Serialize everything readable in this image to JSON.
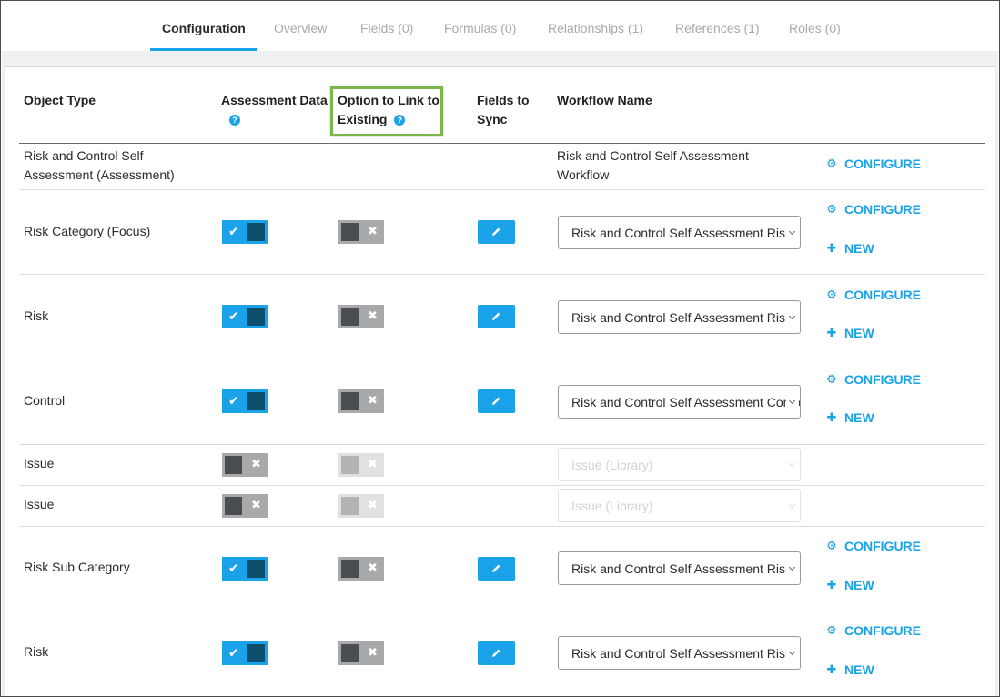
{
  "tabs": [
    {
      "label": "Configuration",
      "active": true
    },
    {
      "label": "Overview"
    },
    {
      "label": "Fields (0)"
    },
    {
      "label": "Formulas (0)"
    },
    {
      "label": "Relationships (1)"
    },
    {
      "label": "References (1)"
    },
    {
      "label": "Roles (0)"
    }
  ],
  "headers": {
    "object_type": "Object Type",
    "assessment_data": "Assessment Data",
    "option_link_1": "Option to Link to",
    "option_link_2": "Existing",
    "fields_sync_1": "Fields to",
    "fields_sync_2": "Sync",
    "workflow_name": "Workflow Name",
    "help_glyph": "?"
  },
  "first_row": {
    "object_line1": "Risk and Control Self",
    "object_line2": "Assessment (Assessment)",
    "workflow_line1": "Risk and Control Self Assessment",
    "workflow_line2": "Workflow",
    "configure": "CONFIGURE"
  },
  "rows": [
    {
      "object": "Risk Category (Focus)",
      "assessment": "on",
      "link": "off",
      "workflow": "Risk and Control Self Assessment Risk",
      "configure": "CONFIGURE",
      "new": "NEW"
    },
    {
      "object": "Risk",
      "assessment": "on",
      "link": "off",
      "workflow": "Risk and Control Self Assessment Risk",
      "configure": "CONFIGURE",
      "new": "NEW"
    },
    {
      "object": "Control",
      "assessment": "on",
      "link": "off",
      "workflow": "Risk and Control Self Assessment Control",
      "configure": "CONFIGURE",
      "new": "NEW"
    },
    {
      "object": "Issue",
      "assessment": "off",
      "link": "disabled",
      "workflow": "Issue (Library)"
    },
    {
      "object": "Issue",
      "assessment": "off",
      "link": "disabled",
      "workflow": "Issue (Library)"
    },
    {
      "object": "Risk Sub Category",
      "assessment": "on",
      "link": "off",
      "workflow": "Risk and Control Self Assessment Risk",
      "configure": "CONFIGURE",
      "new": "NEW"
    },
    {
      "object": "Risk",
      "assessment": "on",
      "link": "off",
      "workflow": "Risk and Control Self Assessment Risk",
      "configure": "CONFIGURE",
      "new": "NEW"
    }
  ],
  "colors": {
    "accent": "#1aa3e8",
    "toggle_knob_on": "#0b4f6c",
    "highlight": "#7ab648"
  },
  "icons": {
    "configure": "gear-icon",
    "new": "plus-icon",
    "edit": "pencil-icon",
    "help": "help-icon"
  }
}
